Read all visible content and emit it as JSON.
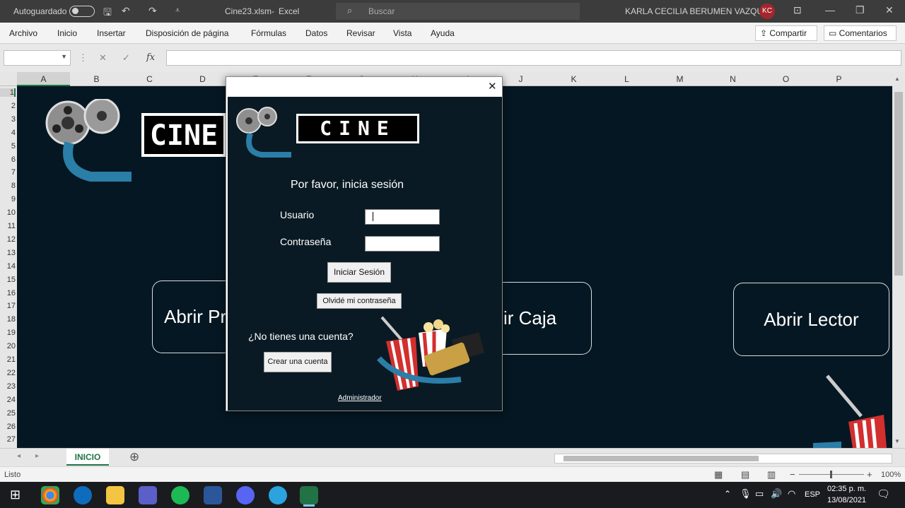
{
  "titlebar": {
    "autosave_label": "Autoguardado",
    "filename": "Cine23.xlsm",
    "separator": "-",
    "app_name": "Excel",
    "search_placeholder": "Buscar",
    "user_name": "KARLA CECILIA BERUMEN VAZQUEZ",
    "user_initials": "KC"
  },
  "ribbon": {
    "tabs": [
      "Archivo",
      "Inicio",
      "Insertar",
      "Disposición de página",
      "Fórmulas",
      "Datos",
      "Revisar",
      "Vista",
      "Ayuda"
    ],
    "share_label": "Compartir",
    "comments_label": "Comentarios"
  },
  "formula_bar": {
    "fx_label": "fx",
    "name_box_value": "",
    "formula_value": ""
  },
  "grid": {
    "columns": [
      "A",
      "B",
      "C",
      "D",
      "E",
      "F",
      "G",
      "H",
      "I",
      "J",
      "K",
      "L",
      "M",
      "N",
      "O",
      "P"
    ],
    "rows": [
      "1",
      "2",
      "3",
      "4",
      "5",
      "6",
      "7",
      "8",
      "9",
      "10",
      "11",
      "12",
      "13",
      "14",
      "15",
      "16",
      "17",
      "18",
      "19",
      "20",
      "21",
      "22",
      "23",
      "24",
      "25",
      "26",
      "27"
    ],
    "selected_cell": "A1"
  },
  "sheet_content": {
    "logo_text": "CINE",
    "buttons": {
      "open_pr": "Abrir Pr",
      "open_caja": "ir Caja",
      "open_lector": "Abrir Lector"
    }
  },
  "sheet_tabs": [
    "INICIO"
  ],
  "status": {
    "text": "Listo",
    "zoom": "100%"
  },
  "login_dialog": {
    "logo_text": "CINE",
    "heading": "Por favor, inicia sesión",
    "user_label": "Usuario",
    "password_label": "Contraseña",
    "login_button": "Iniciar Sesión",
    "forgot_button": "Olvidé mi contraseña",
    "no_account_text": "¿No tienes una cuenta?",
    "create_account_button": "Crear una cuenta",
    "admin_link": "Administrador"
  },
  "taskbar": {
    "language": "ESP",
    "time": "02:35 p. m.",
    "date": "13/08/2021"
  },
  "colors": {
    "sheet_bg": "#051722",
    "excel_green": "#217346",
    "avatar": "#a4262c"
  }
}
